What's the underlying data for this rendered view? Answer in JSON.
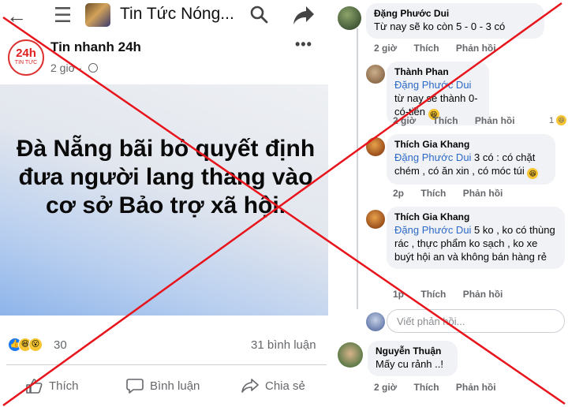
{
  "header": {
    "page_title": "Tin Tức Nóng...",
    "icons": [
      "back-arrow-icon",
      "menu-icon",
      "search-icon",
      "share-icon"
    ]
  },
  "post": {
    "author": "Tin nhanh 24h",
    "logo_text": "24h",
    "logo_sub": "TIN TỨC",
    "time": "2 giờ ·",
    "more": "•••",
    "image_text": "Đà Nẵng bãi bỏ quyết định đưa người lang thang vào cơ sở Bảo trợ xã hội.",
    "reaction_count": "30",
    "comment_count": "31 bình luận",
    "actions": {
      "like": "Thích",
      "comment": "Bình luận",
      "share": "Chia sẻ"
    }
  },
  "comments": [
    {
      "name": "Đặng Phước Dui",
      "text": "Từ nay sẽ ko còn 5 - 0 - 3 có",
      "meta": {
        "time": "2 giờ",
        "like": "Thích",
        "reply": "Phản hồi"
      }
    },
    {
      "name": "Thành Phan",
      "mention": "Đặng Phước Dui",
      "text": " từ nay sẽ thành 0-có-tiền",
      "meta": {
        "time": "2 giờ",
        "like": "Thích",
        "reply": "Phản hồi"
      },
      "reaction_count": "1"
    },
    {
      "name": "Thích Gia Khang",
      "mention": "Đặng Phước Dui",
      "text": " 3 có : có chặt chém , có ăn xin , có móc túi",
      "meta": {
        "time": "2p",
        "like": "Thích",
        "reply": "Phản hồi"
      }
    },
    {
      "name": "Thích Gia Khang",
      "mention": "Đặng Phước Dui",
      "text": " 5 ko , ko có thùng rác , thực phẩm ko sạch , ko xe buýt hội an và không bán hàng rẻ",
      "meta": {
        "time": "1p",
        "like": "Thích",
        "reply": "Phản hồi"
      }
    },
    {
      "name": "Nguyễn Thuận",
      "text": "Mấy cu rảnh ..!",
      "meta": {
        "time": "2 giờ",
        "like": "Thích",
        "reply": "Phản hồi"
      }
    }
  ],
  "reply_placeholder": "Viết phản hồi...",
  "colors": {
    "facebook_blue": "#1877f2",
    "mention": "#2d69c7",
    "cross": "#e8141b"
  }
}
